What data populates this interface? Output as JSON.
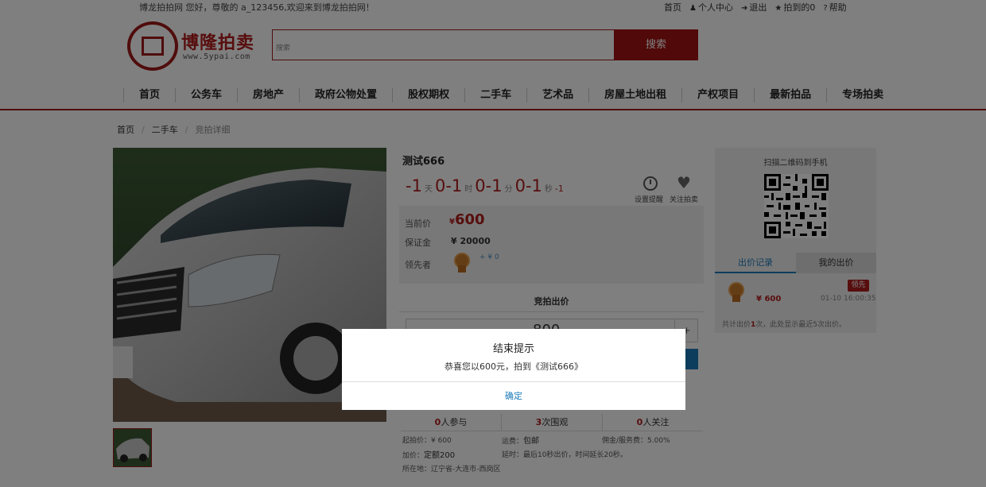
{
  "topbar": {
    "greeting": "博龙拍拍网 您好，尊敬的 a_123456,欢迎来到博龙拍拍网！",
    "links": [
      {
        "label": "首页",
        "icon": ""
      },
      {
        "label": "个人中心",
        "icon": "user-icon"
      },
      {
        "label": "退出",
        "icon": "logout-icon"
      },
      {
        "label": "拍到的0",
        "icon": "trophy-icon"
      },
      {
        "label": "帮助",
        "icon": "question-icon"
      }
    ]
  },
  "logo": {
    "text": "博隆拍卖",
    "url": "www.5ypai.com"
  },
  "search": {
    "placeholder": "搜索",
    "button": "搜索"
  },
  "nav": [
    "首页",
    "公务车",
    "房地产",
    "政府公物处置",
    "股权期权",
    "二手车",
    "艺术品",
    "房屋土地出租",
    "产权项目",
    "最新拍品",
    "专场拍卖"
  ],
  "breadcrumb": [
    "首页",
    "二手车",
    "竞拍详细"
  ],
  "item": {
    "title": "测试666",
    "countdown": {
      "days": "-1",
      "hours": "0-1",
      "minutes": "0-1",
      "seconds": "0-1",
      "extra": "-1",
      "unit_day": "天",
      "unit_hour": "时",
      "unit_min": "分",
      "unit_sec": "秒"
    },
    "reminder_label": "设置提醒",
    "follow_label": "关注拍卖",
    "current_price_label": "当前价",
    "currency": "¥",
    "current_price": "600",
    "deposit_label": "保证金",
    "deposit": "¥ 20000",
    "leader_label": "领先者",
    "leader_value": "+ ¥ 0",
    "bid_section_title": "竞拍出价",
    "bid_amount": "800",
    "plus": "+"
  },
  "stats": [
    {
      "num": "0",
      "label": "人参与"
    },
    {
      "num": "3",
      "label": "次围观"
    },
    {
      "num": "0",
      "label": "人关注"
    }
  ],
  "info": {
    "start_price_label": "起拍价：",
    "start_price": "¥ 600",
    "shipping_label": "运费：",
    "shipping": "包邮",
    "commission_label": "佣金/服务费：",
    "commission": "5.00%",
    "increment_label": "加价：",
    "increment": "定额200",
    "delay_label": "延时：",
    "delay": "最后10秒出价，时间延长20秒。",
    "location_label": "所在地：",
    "location": "辽宁省-大连市-西岗区"
  },
  "right_panel": {
    "qr_title": "扫描二维码到手机",
    "tab_records": "出价记录",
    "tab_mine": "我的出价",
    "record_price": "¥ 600",
    "record_badge": "领先",
    "record_time": "01-10 16:00:35",
    "footer_pre": "共计出价",
    "footer_num": "1",
    "footer_post": "次，此处显示最近5次出价。"
  },
  "modal": {
    "title": "结束提示",
    "message": "恭喜您以600元，拍到《测试666》",
    "ok": "确定"
  },
  "colors": {
    "brand": "#a21212",
    "accent_blue": "#1a7ab8",
    "price_red": "#b01c1c"
  }
}
